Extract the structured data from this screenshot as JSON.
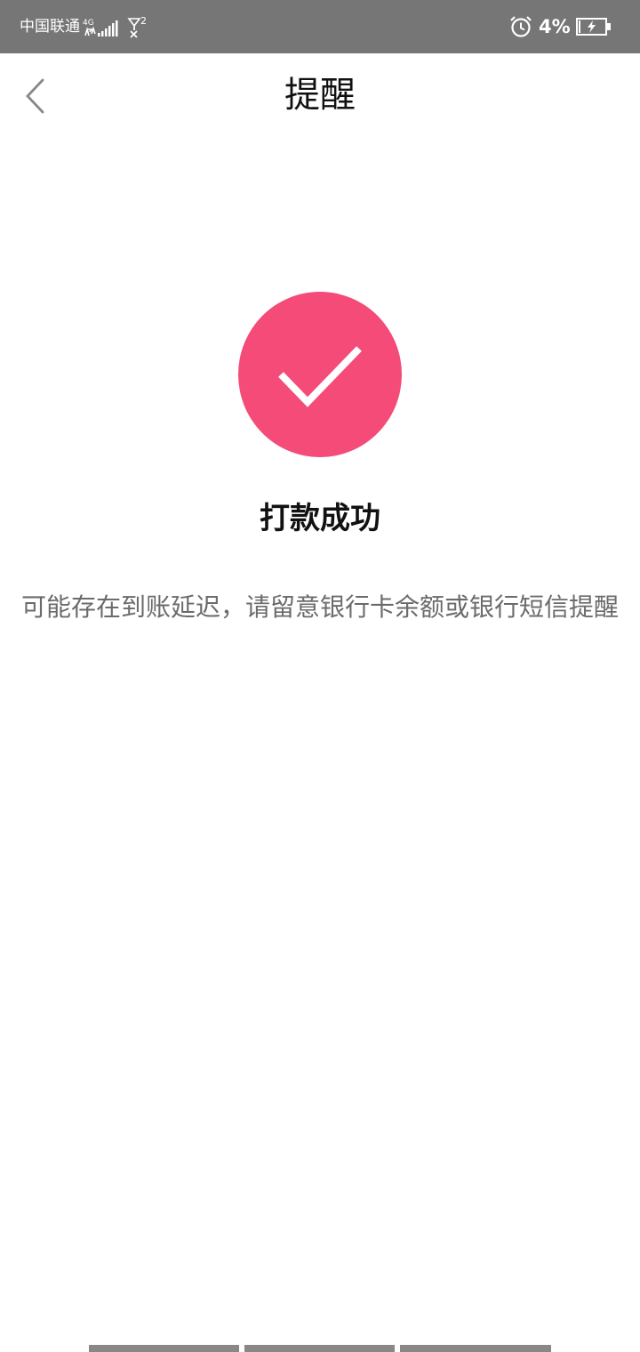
{
  "status_bar": {
    "carrier": "中国联通",
    "network_type": "4G",
    "sim2_label": "2",
    "battery_percent": "4%",
    "battery_level": 0.04,
    "icons": [
      "signal-icon",
      "no-sim-icon",
      "alarm-icon",
      "battery-charging-icon"
    ]
  },
  "nav": {
    "back_icon": "chevron-left-icon",
    "title": "提醒"
  },
  "result": {
    "icon": "check-circle-icon",
    "accent_color": "#f44b78",
    "title": "打款成功",
    "description": "可能存在到账延迟，请留意银行卡余额或银行短信提醒"
  }
}
